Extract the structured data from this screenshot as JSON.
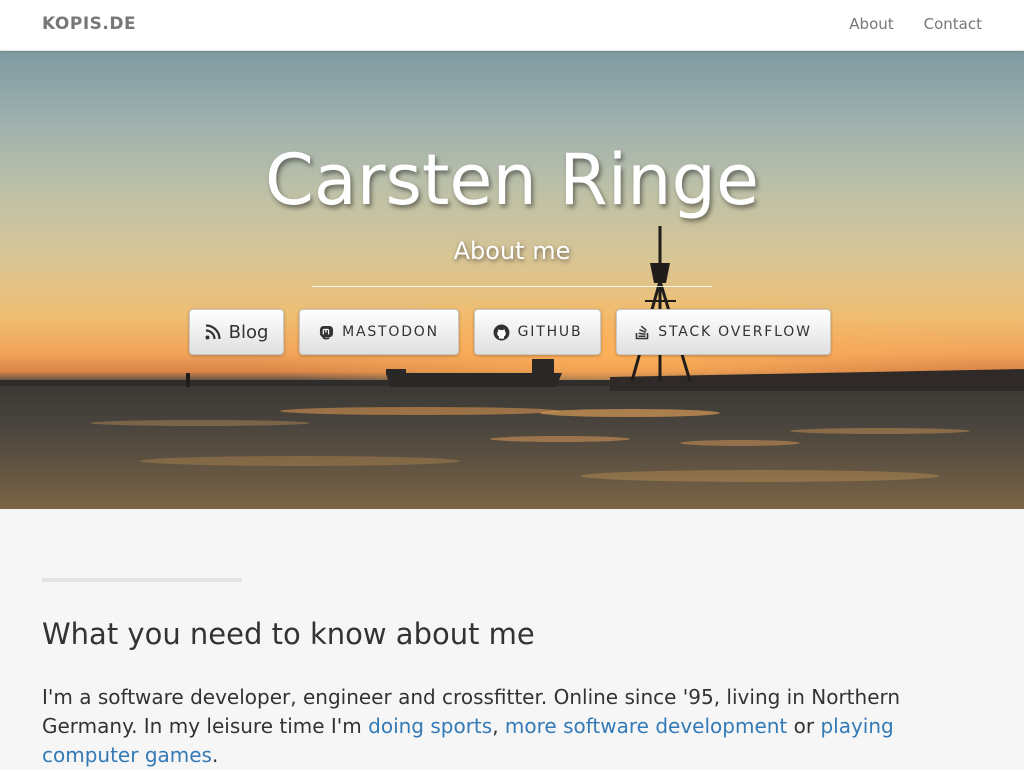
{
  "navbar": {
    "brand": "KOPIS.DE",
    "links": [
      {
        "label": "About"
      },
      {
        "label": "Contact"
      }
    ]
  },
  "hero": {
    "title": "Carsten Ringe",
    "subtitle": "About me",
    "buttons": [
      {
        "label": "Blog",
        "icon": "rss-icon"
      },
      {
        "label": "MASTODON",
        "icon": "mastodon-icon"
      },
      {
        "label": "GITHUB",
        "icon": "github-icon"
      },
      {
        "label": "STACK OVERFLOW",
        "icon": "stack-overflow-icon"
      }
    ]
  },
  "content": {
    "heading": "What you need to know about me",
    "intro_text": "I'm a software developer, engineer and crossfitter. Online since '95, living in Northern Germany. In my leisure time I'm",
    "link_sports": "doing sports",
    "sep_comma": ",",
    "link_dev": "more software development",
    "sep_or": "or",
    "link_games": "playing computer games",
    "end_period": "."
  },
  "colors": {
    "link": "#337ab7",
    "text": "#333333",
    "nav_text": "#777777",
    "page_bg": "#f6f6f6"
  }
}
